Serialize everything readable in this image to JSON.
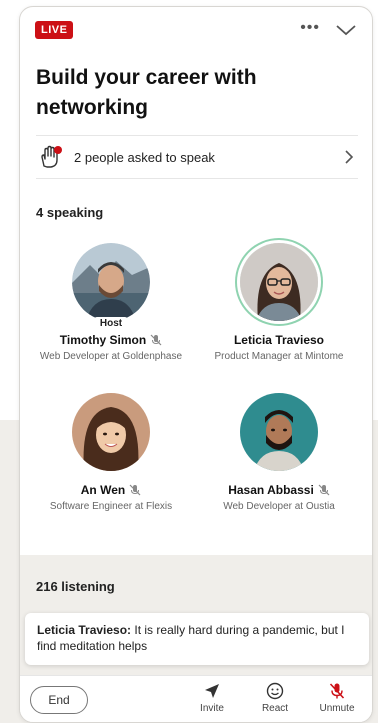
{
  "header": {
    "live_badge": "LIVE",
    "title": "Build your career with networking"
  },
  "ask_row": {
    "text": "2 people asked to speak",
    "icon": "raised-hand-icon"
  },
  "speaking": {
    "label": "4 speaking",
    "speakers": [
      {
        "name": "Timothy Simon",
        "role": "Web Developer at Goldenphase",
        "tag": "Host",
        "muted": true
      },
      {
        "name": "Leticia Travieso",
        "role": "Product Manager at Mintome",
        "muted": false,
        "active": true
      },
      {
        "name": "An Wen",
        "role": "Software Engineer at Flexis",
        "muted": true
      },
      {
        "name": "Hasan Abbassi",
        "role": "Web Developer at Oustia",
        "muted": true
      }
    ]
  },
  "listening": {
    "label": "216 listening"
  },
  "comment": {
    "author": "Leticia Travieso:",
    "text": "It is really hard during a pandemic, but I find meditation helps"
  },
  "bottom_bar": {
    "end_label": "End",
    "invite_label": "Invite",
    "react_label": "React",
    "unmute_label": "Unmute"
  },
  "colors": {
    "live": "#cc1016",
    "active_ring": "#8fd3b0",
    "unmute": "#cc1016"
  }
}
